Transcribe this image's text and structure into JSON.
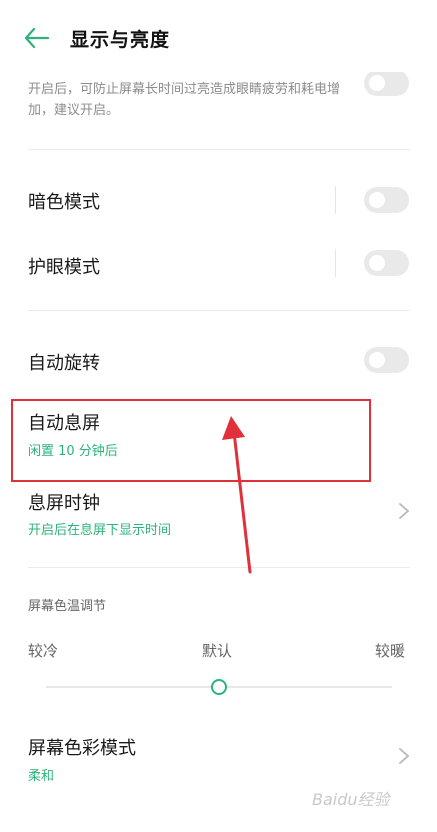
{
  "header": {
    "title": "显示与亮度"
  },
  "auto_brightness": {
    "description": "开启后，可防止屏幕长时间过亮造成眼睛疲劳和耗电增加，建议开启。"
  },
  "dark_mode": {
    "label": "暗色模式",
    "enabled": false
  },
  "eye_care": {
    "label": "护眼模式",
    "enabled": false
  },
  "auto_rotate": {
    "label": "自动旋转",
    "enabled": false
  },
  "auto_screen_off": {
    "label": "自动息屏",
    "value": "闲置 10 分钟后"
  },
  "screen_off_clock": {
    "label": "息屏时钟",
    "subtitle": "开启后在息屏下显示时间"
  },
  "color_temp": {
    "section_title": "屏幕色温调节",
    "cool_label": "较冷",
    "default_label": "默认",
    "warm_label": "较暖",
    "level": 0.5
  },
  "color_mode": {
    "label": "屏幕色彩模式",
    "value": "柔和"
  },
  "watermark": "Baidu经验",
  "colors": {
    "accent": "#2db37a",
    "highlight": "#e0303a"
  }
}
